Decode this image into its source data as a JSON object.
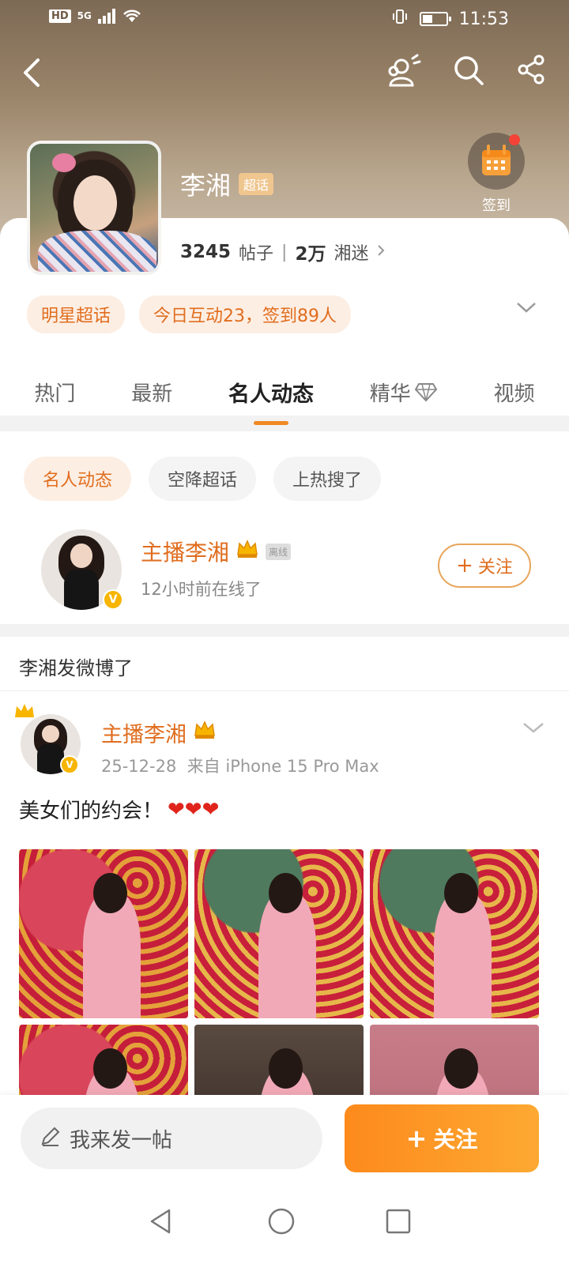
{
  "status_bar": {
    "hd": "HD",
    "network": "5G",
    "time": "11:53"
  },
  "topic": {
    "name": "李湘",
    "tag": "超话",
    "posts_count": "3245",
    "posts_label": "帖子",
    "fans_count": "2万",
    "fans_label": "湘迷"
  },
  "checkin": {
    "label": "签到"
  },
  "pills": [
    "明星超话",
    "今日互动23，签到89人"
  ],
  "tabs": [
    {
      "label": "热门",
      "active": false
    },
    {
      "label": "最新",
      "active": false
    },
    {
      "label": "名人动态",
      "active": true
    },
    {
      "label": "精华",
      "active": false
    },
    {
      "label": "视频",
      "active": false
    }
  ],
  "subfilters": [
    {
      "label": "名人动态",
      "active": true
    },
    {
      "label": "空降超话",
      "active": false
    },
    {
      "label": "上热搜了",
      "active": false
    }
  ],
  "celebrity": {
    "name": "主播李湘",
    "offline_badge": "离线",
    "last_online": "12小时前在线了",
    "follow_label": "关注",
    "verified": "V"
  },
  "section_label": "李湘发微博了",
  "post": {
    "author": "主播李湘",
    "date": "25-12-28",
    "source": "来自 iPhone 15 Pro Max",
    "text": "美女们的约会！",
    "hearts": "❤❤❤",
    "images": 6
  },
  "bottom": {
    "compose_label": "我来发一帖",
    "follow_label": "关注"
  },
  "colors": {
    "accent": "#e06d1e",
    "follow_gradient_start": "#fd8a1c",
    "follow_gradient_end": "#fda932",
    "pill_bg": "#fdeee3"
  }
}
